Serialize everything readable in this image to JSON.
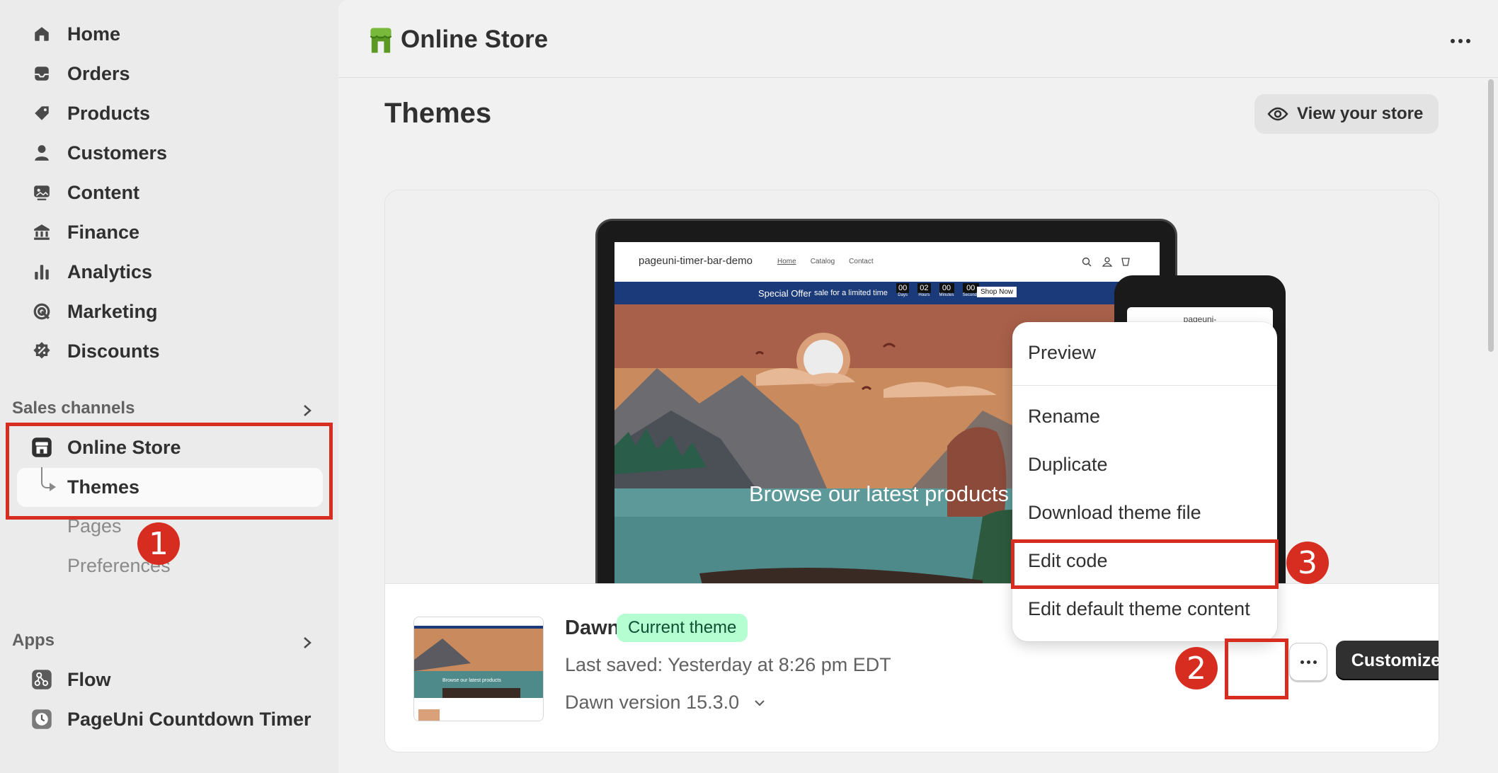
{
  "sidebar": {
    "nav": [
      {
        "label": "Home",
        "icon": "home-icon"
      },
      {
        "label": "Orders",
        "icon": "inbox-icon"
      },
      {
        "label": "Products",
        "icon": "tag-icon"
      },
      {
        "label": "Customers",
        "icon": "person-icon"
      },
      {
        "label": "Content",
        "icon": "image-icon"
      },
      {
        "label": "Finance",
        "icon": "bank-icon"
      },
      {
        "label": "Analytics",
        "icon": "bar-chart-icon"
      },
      {
        "label": "Marketing",
        "icon": "target-icon"
      },
      {
        "label": "Discounts",
        "icon": "discount-icon"
      }
    ],
    "sales_channels_title": "Sales channels",
    "online_store_label": "Online Store",
    "themes_label": "Themes",
    "pages_label": "Pages",
    "preferences_label": "Preferences",
    "apps_title": "Apps",
    "apps": [
      {
        "label": "Flow",
        "icon": "flow-icon"
      },
      {
        "label": "PageUni Countdown Timer",
        "icon": "clock-icon"
      }
    ]
  },
  "header": {
    "title": "Online Store"
  },
  "page": {
    "title": "Themes",
    "view_store_label": "View your store"
  },
  "preview": {
    "site_name": "pageuni-timer-bar-demo",
    "nav_links": [
      "Home",
      "Catalog",
      "Contact"
    ],
    "timer_offer": "Special Offer",
    "timer_sub": "sale for a limited time",
    "timer_digits": [
      "00",
      "02",
      "00",
      "00"
    ],
    "timer_units": [
      "Days",
      "Hours",
      "Minutes",
      "Seconds"
    ],
    "timer_button": "Shop Now",
    "hero_text": "Browse our latest products",
    "phone_text": "pageuni-",
    "thumb_text": "Browse our latest products"
  },
  "theme": {
    "name": "Dawn",
    "badge": "Current theme",
    "last_saved": "Last saved: Yesterday at 8:26 pm EDT",
    "version": "Dawn version 15.3.0",
    "customize_label": "Customize"
  },
  "menu": {
    "items": [
      "Preview",
      "Rename",
      "Duplicate",
      "Download theme file",
      "Edit code",
      "Edit default theme content"
    ]
  },
  "annotations": {
    "step1": "1",
    "step2": "2",
    "step3": "3",
    "color": "#d72c20"
  }
}
